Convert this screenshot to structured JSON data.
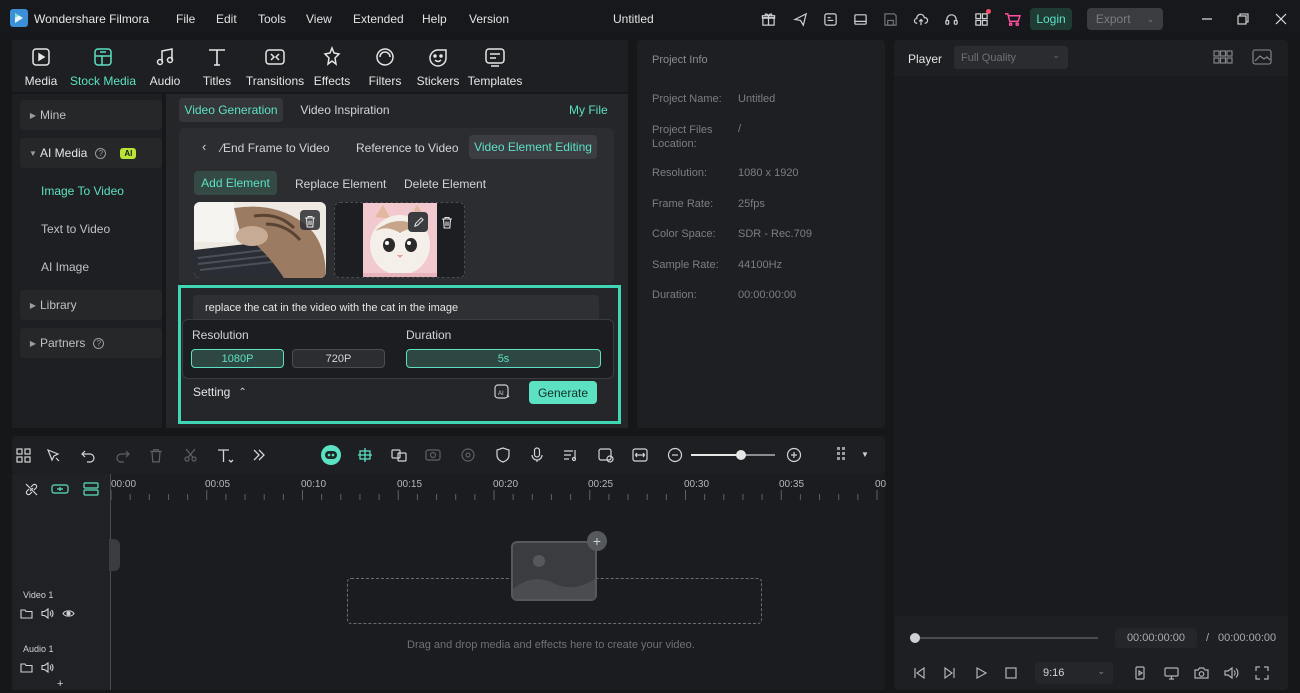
{
  "app": {
    "title": "Wondershare Filmora",
    "document": "Untitled"
  },
  "menu": [
    "File",
    "Edit",
    "Tools",
    "View",
    "Extended",
    "Help",
    "Version"
  ],
  "titlebar": {
    "login": "Login",
    "export": "Export"
  },
  "media_tabs": [
    {
      "label": "Media",
      "icon": "media-icon"
    },
    {
      "label": "Stock Media",
      "icon": "stock-media-icon"
    },
    {
      "label": "Audio",
      "icon": "audio-icon"
    },
    {
      "label": "Titles",
      "icon": "titles-icon"
    },
    {
      "label": "Transitions",
      "icon": "transitions-icon"
    },
    {
      "label": "Effects",
      "icon": "effects-icon"
    },
    {
      "label": "Filters",
      "icon": "filters-icon"
    },
    {
      "label": "Stickers",
      "icon": "stickers-icon"
    },
    {
      "label": "Templates",
      "icon": "templates-icon"
    }
  ],
  "sidebar": {
    "mine": "Mine",
    "ai_media": "AI Media",
    "ai_badge": "AI",
    "image_to_video": "Image To Video",
    "text_to_video": "Text to Video",
    "ai_image": "AI Image",
    "library": "Library",
    "partners": "Partners"
  },
  "main": {
    "tab_video_generation": "Video Generation",
    "tab_video_inspiration": "Video Inspiration",
    "my_file": "My File",
    "sub_tab_end_frame": "⁄End Frame to Video",
    "sub_tab_reference": "Reference to Video",
    "sub_tab_element_editing": "Video Element Editing",
    "action_add": "Add Element",
    "action_replace": "Replace Element",
    "action_delete": "Delete Element",
    "prompt": "replace the cat in the video with the cat in the image",
    "resolution_label": "Resolution",
    "res_1080": "1080P",
    "res_720": "720P",
    "duration_label": "Duration",
    "duration_value": "5s",
    "setting": "Setting",
    "generate": "Generate"
  },
  "project_info": {
    "title": "Project Info",
    "rows": [
      {
        "key": "Project Name:",
        "value": "Untitled"
      },
      {
        "key": "Project Files Location:",
        "value": "/"
      },
      {
        "key": "Resolution:",
        "value": "1080 x 1920"
      },
      {
        "key": "Frame Rate:",
        "value": "25fps"
      },
      {
        "key": "Color Space:",
        "value": "SDR - Rec.709"
      },
      {
        "key": "Sample Rate:",
        "value": "44100Hz"
      },
      {
        "key": "Duration:",
        "value": "00:00:00:00"
      }
    ]
  },
  "player": {
    "label": "Player",
    "quality": "Full Quality",
    "current_time": "00:00:00:00",
    "separator": "/",
    "total_time": "00:00:00:00",
    "ratio": "9:16"
  },
  "timeline": {
    "ruler": [
      "00:00",
      "00:05",
      "00:10",
      "00:15",
      "00:20",
      "00:25",
      "00:30",
      "00:35",
      "00"
    ],
    "track_video": "Video 1",
    "track_audio": "Audio 1",
    "drop_hint": "Drag and drop media and effects here to create your video."
  },
  "colors": {
    "accent": "#5ce1c2",
    "highlight_border": "#3fd6b6",
    "bg": "#161719",
    "panel": "#1e1f22"
  }
}
